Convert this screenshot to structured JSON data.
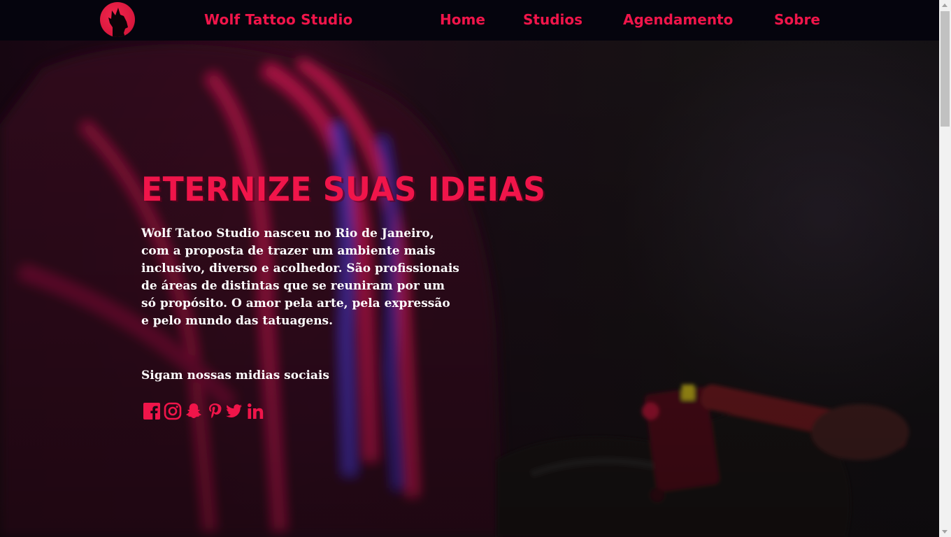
{
  "header": {
    "brand": "Wolf Tattoo Studio",
    "logo": "wolf-head-logo",
    "nav": [
      {
        "label": "Home"
      },
      {
        "label": "Studios"
      },
      {
        "label": "Agendamento"
      },
      {
        "label": "Sobre"
      }
    ]
  },
  "hero": {
    "headline": "ETERNIZE SUAS IDEIAS",
    "intro": "Wolf Tatoo Studio nasceu no Rio de Janeiro, com a proposta de trazer um ambiente mais inclusivo, diverso e acolhedor. São profissionais de áreas de distintas que se reuniram por um só propósito. O amor pela arte, pela expressão e pelo mundo das tatuagens.",
    "social_label": "Sigam nossas midias sociais",
    "social_icons": [
      "facebook-icon",
      "instagram-icon",
      "snapchat-icon",
      "pinterest-icon",
      "twitter-icon",
      "linkedin-icon"
    ],
    "background": "tattoo-artist-photo"
  },
  "colors": {
    "accent": "#f0154a",
    "topbar": "#05040d",
    "text": "#ffffff"
  }
}
